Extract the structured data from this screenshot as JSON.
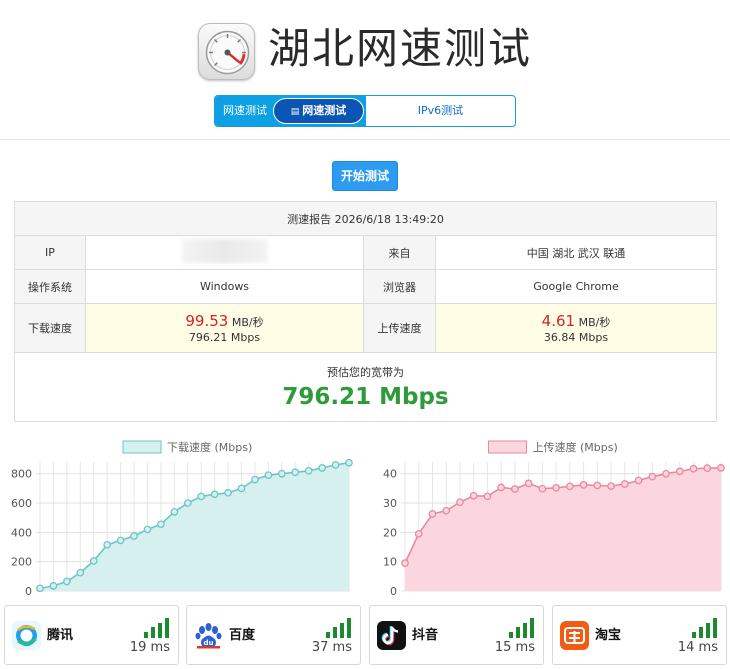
{
  "header": {
    "title": "湖北网速测试",
    "logo_icon": "speedometer-icon"
  },
  "tabs": {
    "active_prefix": "网速测试",
    "active_label": "网速测试",
    "active_icon": "table-icon",
    "other_label": "IPv6测试"
  },
  "start_button": {
    "label": "开始测试"
  },
  "report": {
    "caption": "测速报告 2026/6/18 13:49:20",
    "ip_label": "IP",
    "from_label": "来自",
    "from_value": "中国 湖北 武汉 联通",
    "os_label": "操作系统",
    "os_value": "Windows",
    "browser_label": "浏览器",
    "browser_value": "Google Chrome",
    "download_label": "下载速度",
    "download_value": "99.53",
    "download_unit": "MB/秒",
    "download_mbps": "796.21 Mbps",
    "upload_label": "上传速度",
    "upload_value": "4.61",
    "upload_unit": "MB/秒",
    "upload_mbps": "36.84 Mbps",
    "bandwidth_label": "预估您的宽带为",
    "bandwidth_value": "796.21 Mbps"
  },
  "chart_data": [
    {
      "type": "area",
      "title": "",
      "legend": "下载速度 (Mbps)",
      "color": "#6cc6c6",
      "fill": "#d6efef",
      "ylim": [
        0,
        880
      ],
      "yticks": [
        0,
        200,
        400,
        600,
        800
      ],
      "grid": true,
      "legend_placement": "top-center",
      "values": [
        18,
        35,
        65,
        125,
        205,
        315,
        345,
        375,
        420,
        455,
        540,
        600,
        645,
        660,
        670,
        700,
        760,
        790,
        800,
        810,
        820,
        840,
        860,
        875
      ]
    },
    {
      "type": "area",
      "title": "",
      "legend": "上传速度 (Mbps)",
      "color": "#e88a9e",
      "fill": "#fbd6de",
      "ylim": [
        0,
        44
      ],
      "yticks": [
        0,
        10,
        20,
        30,
        40
      ],
      "grid": true,
      "legend_placement": "top-center",
      "values": [
        9.5,
        19.5,
        26.3,
        27.4,
        30.3,
        32.5,
        32.3,
        35.3,
        34.8,
        36.7,
        34.9,
        35.2,
        35.7,
        36.2,
        36.0,
        35.8,
        36.5,
        37.7,
        39.0,
        40.0,
        40.8,
        41.7,
        41.9,
        42.0
      ]
    }
  ],
  "services": [
    {
      "name": "腾讯",
      "ping": "19 ms",
      "icon": "tencent-icon",
      "color": "#1aa3ec"
    },
    {
      "name": "百度",
      "ping": "37 ms",
      "icon": "baidu-paw-icon",
      "color": "#2b60d8"
    },
    {
      "name": "抖音",
      "ping": "15 ms",
      "icon": "tiktok-icon",
      "color": "#111111"
    },
    {
      "name": "淘宝",
      "ping": "14 ms",
      "icon": "taobao-icon",
      "color": "#f25b14"
    }
  ],
  "colors": {
    "accent": "#0ea0e4",
    "button": "#2d9bf0",
    "bandwidth": "#2f9a3a",
    "speed": "#d12525",
    "signal": "#1c8a2c"
  }
}
